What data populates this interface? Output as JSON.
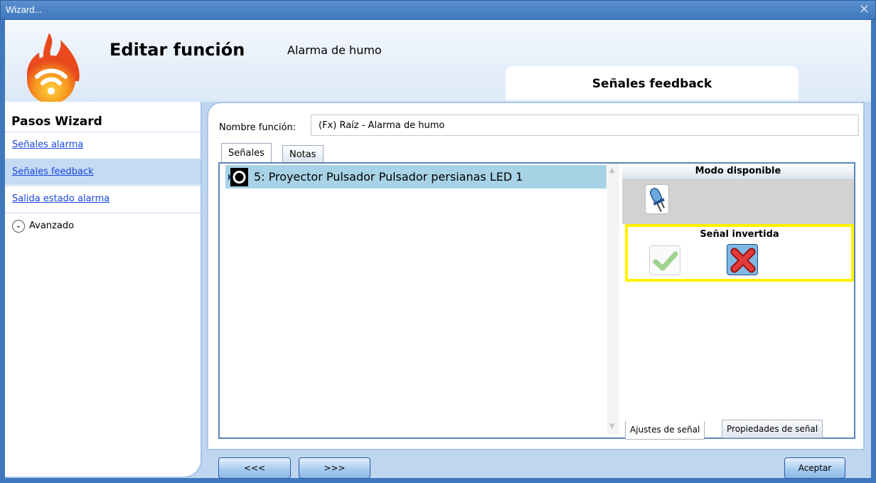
{
  "window": {
    "title": "Wizard...",
    "close_glyph": "✕"
  },
  "header": {
    "title": "Editar función",
    "subtitle": "Alarma de humo",
    "current_step": "Señales feedback",
    "logo_icon": "fire-wifi-icon"
  },
  "sidebar": {
    "title": "Pasos Wizard",
    "items": [
      {
        "label": "Señales alarma"
      },
      {
        "label": "Señales feedback"
      },
      {
        "label": "Salida estado alarma"
      }
    ],
    "advanced_label": "Avanzado"
  },
  "form": {
    "name_label": "Nombre función:",
    "name_value": "(Fx) Raíz - Alarma de humo"
  },
  "tabs": [
    {
      "label": "Señales"
    },
    {
      "label": "Notas"
    }
  ],
  "signals": [
    {
      "label": "5: Proyector Pulsador Pulsador persianas LED 1",
      "icon": "push-button-icon"
    }
  ],
  "panel": {
    "modo_title": "Modo disponible",
    "modo_icon": "led-icon",
    "invertida_title": "Señal invertida",
    "tabs": [
      {
        "label": "Ajustes de señal"
      },
      {
        "label": "Propiedades de señal"
      }
    ]
  },
  "footer": {
    "prev_label": "<<<",
    "next_label": ">>>",
    "accept_label": "Aceptar"
  },
  "colors": {
    "titlebar": "#3f78bd",
    "selected_row": "#a8d3e6",
    "highlight_box": "#fff200",
    "link": "#1a46e0"
  }
}
